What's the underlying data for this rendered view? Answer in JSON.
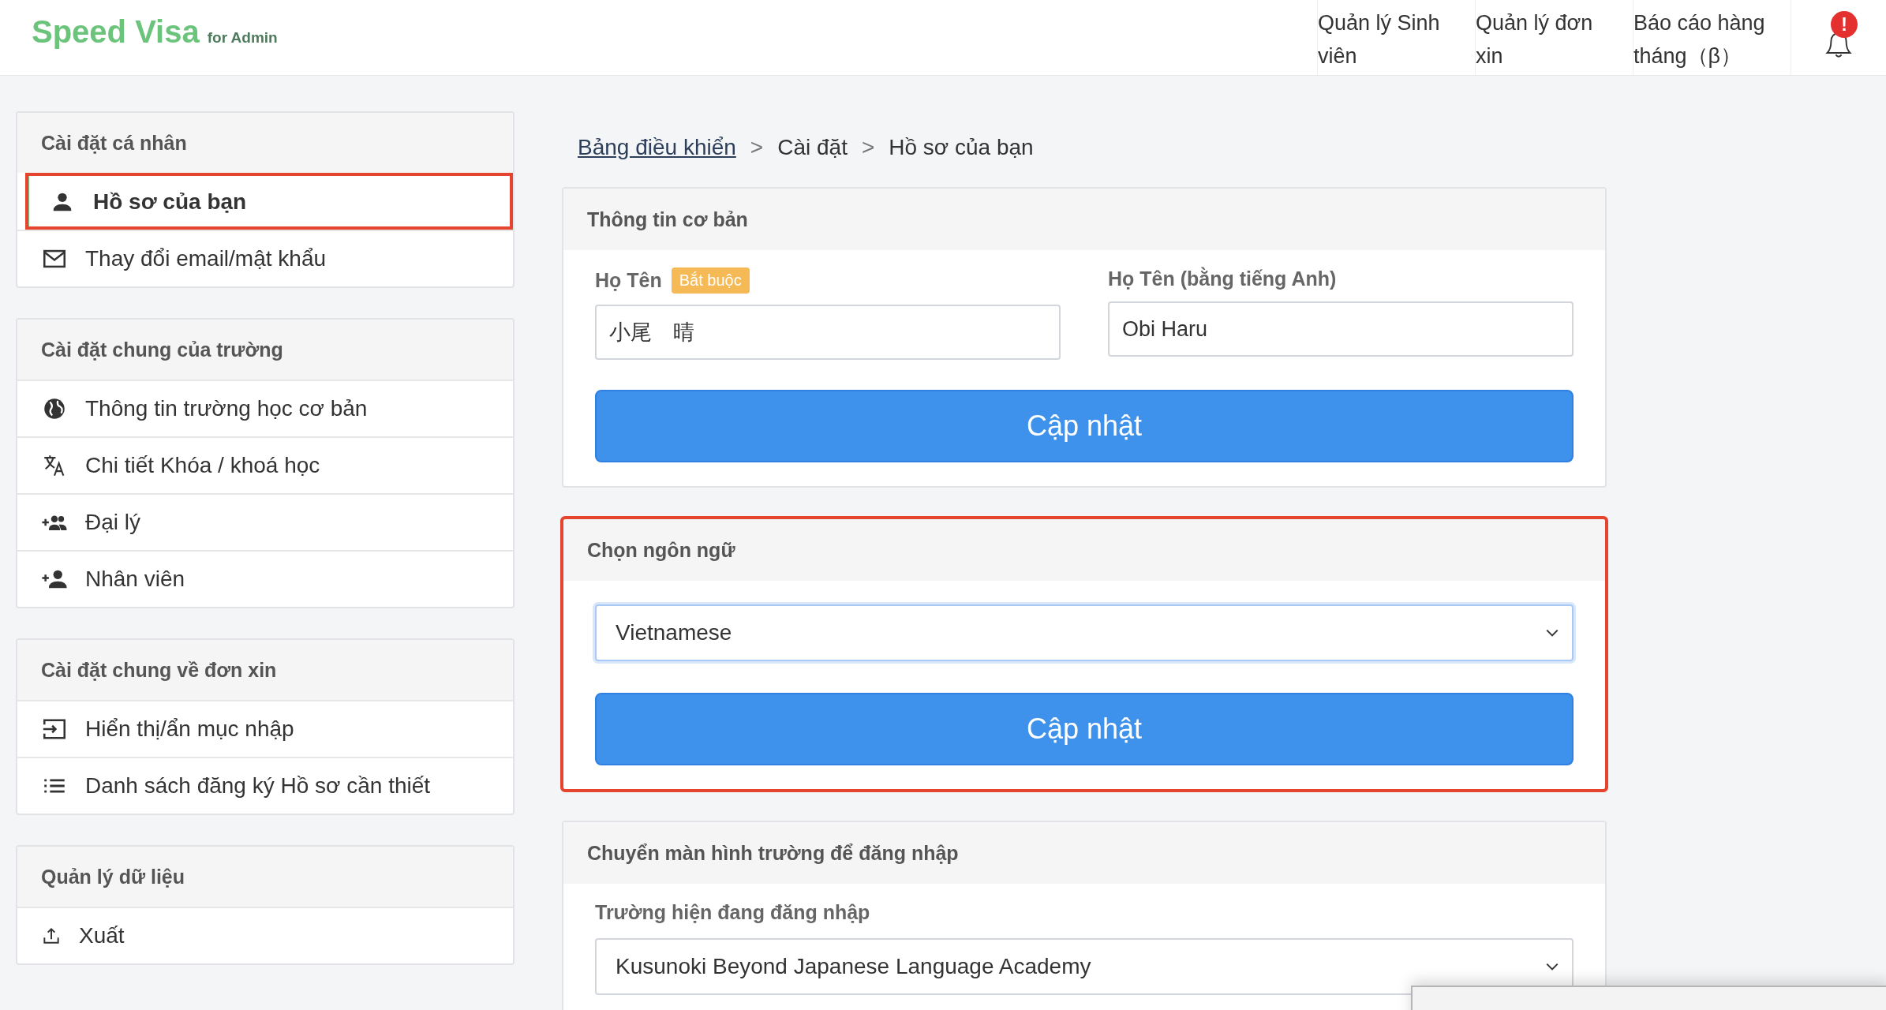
{
  "header": {
    "logo": "Speed Visa",
    "logo_suffix": "for Admin",
    "nav": [
      {
        "label": "Quản lý Sinh viên"
      },
      {
        "label": "Quản lý đơn xin"
      },
      {
        "label": "Báo cáo hàng tháng（β）"
      }
    ],
    "notification_badge": "!"
  },
  "sidebar": {
    "sections": [
      {
        "title": "Cài đặt cá nhân",
        "items": [
          {
            "kind": "person",
            "label": "Hồ sơ của bạn",
            "selected": true,
            "highlighted": true
          },
          {
            "kind": "mail",
            "label": "Thay đổi email/mật khẩu",
            "selected": false,
            "highlighted": false
          }
        ]
      },
      {
        "title": "Cài đặt chung của trường",
        "items": [
          {
            "kind": "globe",
            "label": "Thông tin trường học cơ bản",
            "selected": false,
            "highlighted": false
          },
          {
            "kind": "translate",
            "label": "Chi tiết Khóa / khoá học",
            "selected": false,
            "highlighted": false
          },
          {
            "kind": "group-add",
            "label": "Đại lý",
            "selected": false,
            "highlighted": false
          },
          {
            "kind": "person-add",
            "label": "Nhân viên",
            "selected": false,
            "highlighted": false
          }
        ]
      },
      {
        "title": "Cài đặt chung về đơn xin",
        "items": [
          {
            "kind": "input",
            "label": "Hiển thị/ẩn mục nhập",
            "selected": false,
            "highlighted": false
          },
          {
            "kind": "list",
            "label": "Danh sách đăng ký Hồ sơ cần thiết",
            "selected": false,
            "highlighted": false
          }
        ]
      },
      {
        "title": "Quản lý dữ liệu",
        "items": [
          {
            "kind": "upload",
            "label": "Xuất",
            "selected": false,
            "highlighted": false
          }
        ]
      }
    ]
  },
  "breadcrumb": [
    {
      "label": "Bảng điều khiển",
      "link": true
    },
    {
      "label": "Cài đặt",
      "link": false
    },
    {
      "label": "Hồ sơ của bạn",
      "link": false
    }
  ],
  "breadcrumb_separator": ">",
  "cards": [
    {
      "kind": "name-form",
      "title": "Thông tin cơ bản",
      "highlighted": false,
      "fields": [
        {
          "label": "Họ Tên",
          "badge": "Bắt buộc",
          "value": "小尾　晴"
        },
        {
          "label": "Họ Tên (bằng tiếng Anh)",
          "value": "Obi Haru"
        }
      ],
      "button": "Cập nhật"
    },
    {
      "kind": "language",
      "title": "Chọn ngôn ngữ",
      "highlighted": true,
      "select": "Vietnamese",
      "button": "Cập nhật"
    },
    {
      "kind": "school",
      "title": "Chuyển màn hình trường để đăng nhập",
      "highlighted": false,
      "field_label": "Trường hiện đang đăng nhập",
      "select": "Kusunoki Beyond Japanese Language Academy"
    }
  ]
}
